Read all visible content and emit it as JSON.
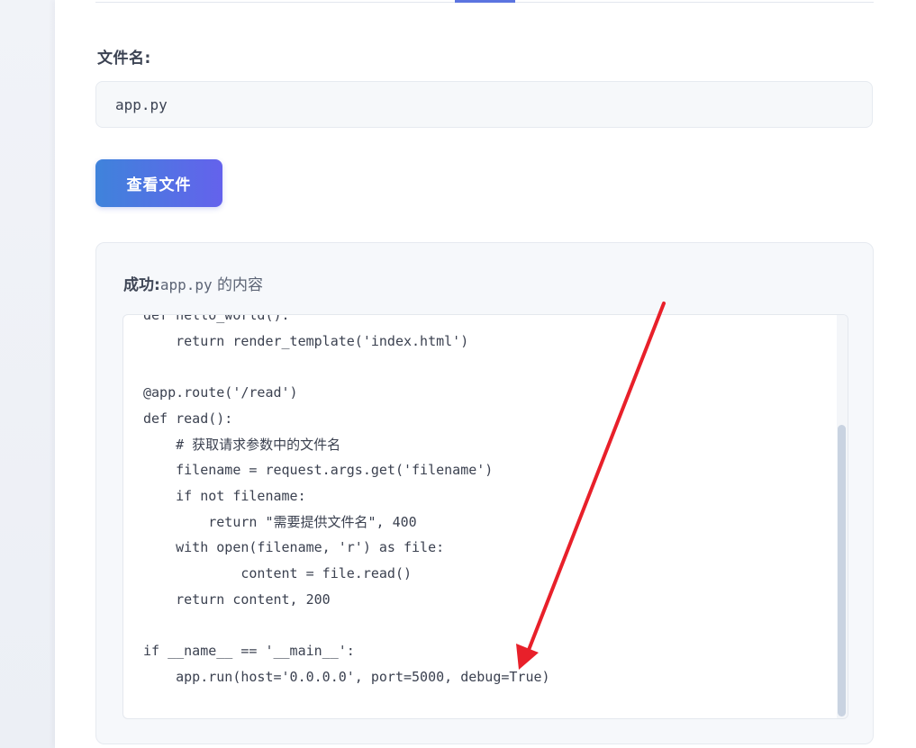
{
  "form": {
    "filename_label": "文件名:",
    "filename_value": "app.py",
    "submit_label": "查看文件"
  },
  "result": {
    "status_label": "成功:",
    "filename": "app.py",
    "suffix": " 的内容",
    "code_lines": [
      "def hello_world():",
      "    return render_template('index.html')",
      "",
      "@app.route('/read')",
      "def read():",
      "    # 获取请求参数中的文件名",
      "    filename = request.args.get('filename')",
      "    if not filename:",
      "        return \"需要提供文件名\", 400",
      "    with open(filename, 'r') as file:",
      "            content = file.read()",
      "    return content, 200",
      "",
      "if __name__ == '__main__':",
      "    app.run(host='0.0.0.0', port=5000, debug=True)"
    ]
  },
  "scrollbar": {
    "position_fraction": 0.28
  },
  "colors": {
    "accent": "#5b74e0",
    "button_gradient_start": "#3f83db",
    "button_gradient_end": "#6462ec",
    "annotation_arrow": "#e8202a"
  }
}
